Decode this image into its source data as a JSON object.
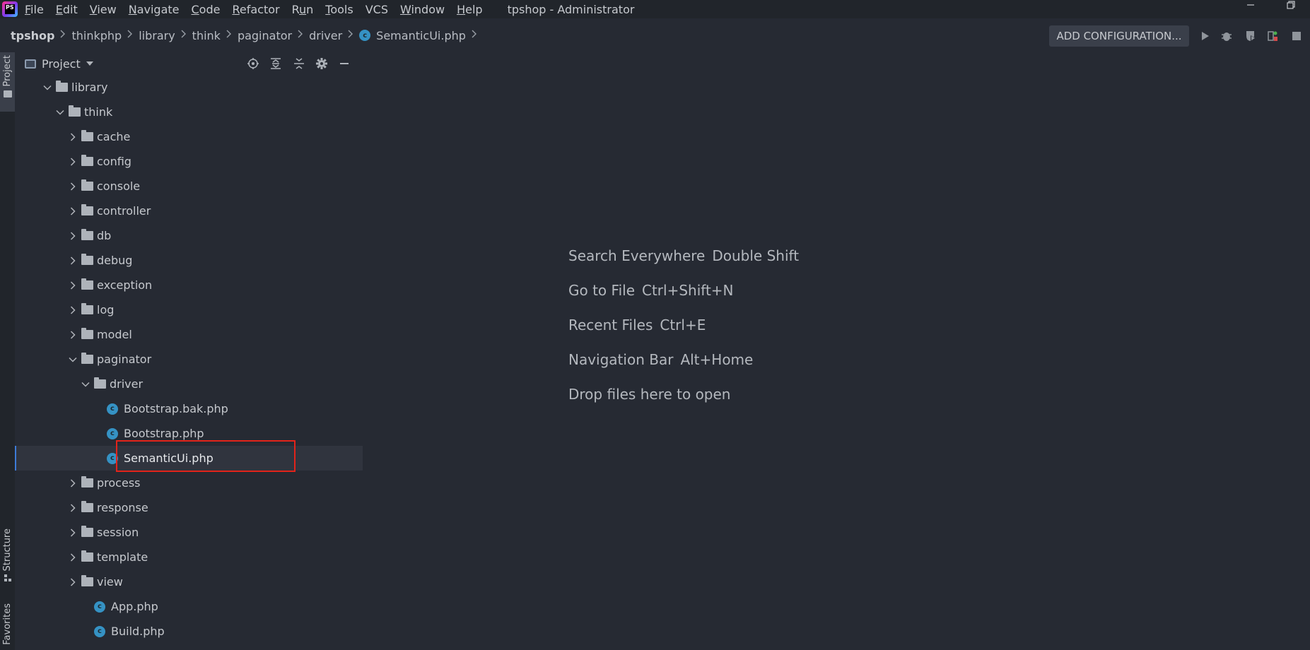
{
  "window": {
    "title": "tpshop - Administrator"
  },
  "menu": {
    "items": [
      {
        "label": "File",
        "mnemonic": "F",
        "rest": "ile"
      },
      {
        "label": "Edit",
        "mnemonic": "E",
        "rest": "dit"
      },
      {
        "label": "View",
        "mnemonic": "V",
        "rest": "iew"
      },
      {
        "label": "Navigate",
        "mnemonic": "N",
        "rest": "avigate"
      },
      {
        "label": "Code",
        "mnemonic": "C",
        "rest": "ode"
      },
      {
        "label": "Refactor",
        "mnemonic": "R",
        "rest": "efactor"
      },
      {
        "label": "Run",
        "mnemonic": "u",
        "pre": "R",
        "rest": "n"
      },
      {
        "label": "Tools",
        "mnemonic": "T",
        "rest": "ools"
      },
      {
        "label": "VCS",
        "mnemonic": "",
        "rest": "VCS"
      },
      {
        "label": "Window",
        "mnemonic": "W",
        "rest": "indow"
      },
      {
        "label": "Help",
        "mnemonic": "H",
        "rest": "elp"
      }
    ]
  },
  "breadcrumb": {
    "items": [
      "tpshop",
      "thinkphp",
      "library",
      "think",
      "paginator",
      "driver",
      "SemanticUi.php"
    ]
  },
  "toolbar": {
    "config_label": "ADD CONFIGURATION...",
    "icons": [
      "run-icon",
      "debug-icon",
      "coverage-icon",
      "profile-icon",
      "stop-icon"
    ]
  },
  "side_stripe": {
    "project_tab": "Project",
    "structure_tab": "Structure",
    "favorites_tab": "Favorites"
  },
  "project_panel": {
    "title": "Project",
    "header_icons": [
      "locate-icon",
      "expand-all-icon",
      "collapse-all-icon",
      "settings-icon",
      "hide-icon"
    ],
    "tree": [
      {
        "label": "library",
        "type": "folder",
        "expanded": true,
        "depth": 0
      },
      {
        "label": "think",
        "type": "folder",
        "expanded": true,
        "depth": 1
      },
      {
        "label": "cache",
        "type": "folder",
        "expanded": false,
        "depth": 2
      },
      {
        "label": "config",
        "type": "folder",
        "expanded": false,
        "depth": 2
      },
      {
        "label": "console",
        "type": "folder",
        "expanded": false,
        "depth": 2
      },
      {
        "label": "controller",
        "type": "folder",
        "expanded": false,
        "depth": 2
      },
      {
        "label": "db",
        "type": "folder",
        "expanded": false,
        "depth": 2
      },
      {
        "label": "debug",
        "type": "folder",
        "expanded": false,
        "depth": 2
      },
      {
        "label": "exception",
        "type": "folder",
        "expanded": false,
        "depth": 2
      },
      {
        "label": "log",
        "type": "folder",
        "expanded": false,
        "depth": 2
      },
      {
        "label": "model",
        "type": "folder",
        "expanded": false,
        "depth": 2
      },
      {
        "label": "paginator",
        "type": "folder",
        "expanded": true,
        "depth": 2
      },
      {
        "label": "driver",
        "type": "folder",
        "expanded": true,
        "depth": 3
      },
      {
        "label": "Bootstrap.bak.php",
        "type": "php-class",
        "depth": 4
      },
      {
        "label": "Bootstrap.php",
        "type": "php-class",
        "depth": 4
      },
      {
        "label": "SemanticUi.php",
        "type": "php-class",
        "depth": 4,
        "selected": true
      },
      {
        "label": "process",
        "type": "folder",
        "expanded": false,
        "depth": 2
      },
      {
        "label": "response",
        "type": "folder",
        "expanded": false,
        "depth": 2
      },
      {
        "label": "session",
        "type": "folder",
        "expanded": false,
        "depth": 2
      },
      {
        "label": "template",
        "type": "folder",
        "expanded": false,
        "depth": 2
      },
      {
        "label": "view",
        "type": "folder",
        "expanded": false,
        "depth": 2
      },
      {
        "label": "App.php",
        "type": "php-class",
        "depth": 3
      },
      {
        "label": "Build.php",
        "type": "php-class",
        "depth": 3
      }
    ]
  },
  "editor": {
    "hints": [
      {
        "text": "Search Everywhere",
        "shortcut": "Double Shift"
      },
      {
        "text": "Go to File",
        "shortcut": "Ctrl+Shift+N"
      },
      {
        "text": "Recent Files",
        "shortcut": "Ctrl+E"
      },
      {
        "text": "Navigation Bar",
        "shortcut": "Alt+Home"
      },
      {
        "text": "Drop files here to open",
        "shortcut": ""
      }
    ]
  },
  "colors": {
    "background": "#262a33",
    "menubar": "#21252b",
    "selection_accent": "#3d7bd8",
    "highlight_box": "#e2231a",
    "php_class_icon": "#3592c4"
  }
}
